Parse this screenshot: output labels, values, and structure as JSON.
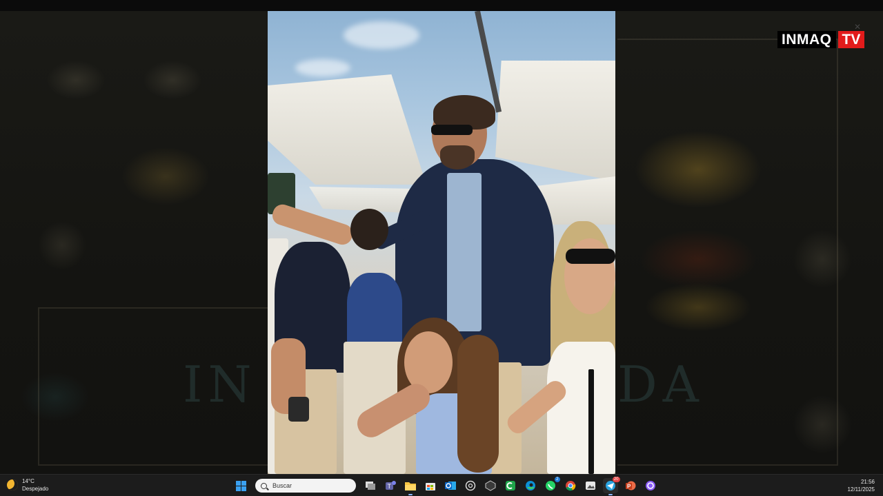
{
  "overlay": {
    "logo_main": "INMAQ",
    "logo_tv": "TV",
    "brand_colors": {
      "logo_bg": "#000000",
      "logo_tv_bg": "#e21b1b"
    }
  },
  "taskbar": {
    "weather": {
      "temperature": "14°C",
      "condition": "Despejado",
      "icon": "moon-icon"
    },
    "search_placeholder": "Buscar",
    "apps": [
      {
        "name": "start-icon"
      },
      {
        "name": "task-view-icon"
      },
      {
        "name": "teams-icon"
      },
      {
        "name": "file-explorer-icon"
      },
      {
        "name": "store-icon"
      },
      {
        "name": "outlook-icon"
      },
      {
        "name": "chatgpt-icon"
      },
      {
        "name": "app-icon"
      },
      {
        "name": "camtasia-icon"
      },
      {
        "name": "edge-icon"
      },
      {
        "name": "whatsapp-icon",
        "badge": "2"
      },
      {
        "name": "chrome-icon"
      },
      {
        "name": "photo-app-icon"
      },
      {
        "name": "telegram-icon",
        "badge": "20"
      },
      {
        "name": "powerpoint-icon"
      },
      {
        "name": "circle-app-icon"
      }
    ],
    "clock": {
      "time": "21:56",
      "date": "12/11/2025"
    }
  }
}
